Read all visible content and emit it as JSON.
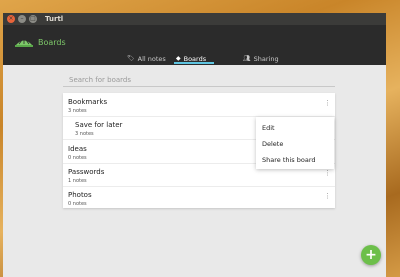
{
  "window": {
    "title": "Turtl"
  },
  "app": {
    "section": "Boards"
  },
  "tabs": [
    {
      "label": "All notes",
      "icon": "tag-icon"
    },
    {
      "label": "Boards",
      "icon": "bookmark-icon"
    },
    {
      "label": "Sharing",
      "icon": "users-icon"
    }
  ],
  "search": {
    "placeholder": "Search for boards"
  },
  "boards": [
    {
      "name": "Bookmarks",
      "count": "3 notes"
    },
    {
      "name": "Save for later",
      "count": "3 notes"
    },
    {
      "name": "Ideas",
      "count": "0 notes"
    },
    {
      "name": "Passwords",
      "count": "1 notes"
    },
    {
      "name": "Photos",
      "count": "0 notes"
    }
  ],
  "context_menu": [
    "Edit",
    "Delete",
    "Share this board"
  ],
  "fab": {
    "label": "+"
  },
  "colors": {
    "accent_green": "#6cbf4a",
    "tab_underline": "#5ec4e0",
    "appbar": "#2b2b2b"
  }
}
